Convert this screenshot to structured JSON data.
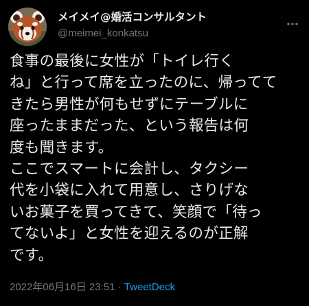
{
  "author": {
    "display_name": "メイメイ@婚活コンサルタント",
    "handle": "@meimei_konkatsu",
    "avatar_icon": "red-panda-avatar"
  },
  "tweet": {
    "lines": [
      "食事の最後に女性が「トイレ行く",
      "ね」と行って席を立ったのに、帰ってて",
      "きたら男性が何もせずにテーブルに",
      "座ったままだった、という報告は何",
      "度も聞きます。",
      "ここでスマートに会計し、タクシー",
      "代を小袋に入れて用意し、さりげな",
      "いお菓子を買ってきて、笑顔で「待っ",
      "てないよ」と女性を迎えるのが正解",
      "です。"
    ]
  },
  "meta": {
    "timestamp": "2022年06月16日 23:51",
    "separator": "·",
    "source": "TweetDeck"
  },
  "colors": {
    "background": "#000000",
    "text": "#e7e9ea",
    "secondary": "#71767b",
    "link": "#1d9bf0"
  }
}
